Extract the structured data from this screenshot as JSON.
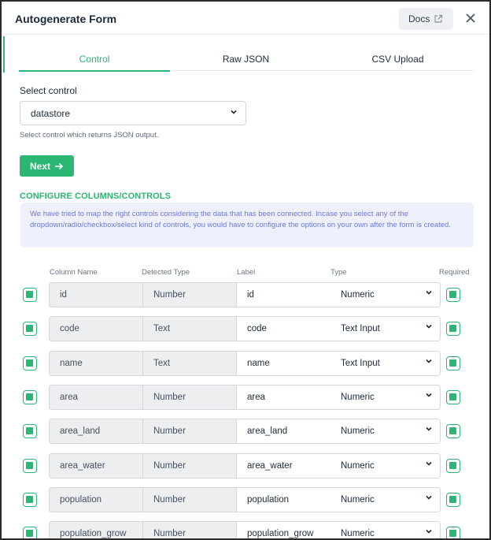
{
  "header": {
    "title": "Autogenerate Form",
    "docs_label": "Docs"
  },
  "tabs": [
    {
      "label": "Control",
      "active": true
    },
    {
      "label": "Raw JSON",
      "active": false
    },
    {
      "label": "CSV Upload",
      "active": false
    }
  ],
  "control": {
    "label": "Select control",
    "value": "datastore",
    "hint": "Select control which returns JSON output.",
    "next_label": "Next"
  },
  "configure": {
    "title": "CONFIGURE COLUMNS/CONTROLS",
    "info": "We have tried to map the right controls considering the data that has been connected. Incase you select any of the dropdown/radio/checkbox/select kind of controls, you would have to configure the options on your own after the form is created."
  },
  "columns": {
    "headers": [
      "Column Name",
      "Detected Type",
      "Label",
      "Type",
      "Required"
    ],
    "rows": [
      {
        "name": "id",
        "detected": "Number",
        "label": "id",
        "type": "Numeric"
      },
      {
        "name": "code",
        "detected": "Text",
        "label": "code",
        "type": "Text Input"
      },
      {
        "name": "name",
        "detected": "Text",
        "label": "name",
        "type": "Text Input"
      },
      {
        "name": "area",
        "detected": "Number",
        "label": "area",
        "type": "Numeric"
      },
      {
        "name": "area_land",
        "detected": "Number",
        "label": "area_land",
        "type": "Numeric"
      },
      {
        "name": "area_water",
        "detected": "Number",
        "label": "area_water",
        "type": "Numeric"
      },
      {
        "name": "population",
        "detected": "Number",
        "label": "population",
        "type": "Numeric"
      },
      {
        "name": "population_grow",
        "detected": "Number",
        "label": "population_grow",
        "type": "Numeric"
      }
    ]
  },
  "colors": {
    "accent": "#2cb673",
    "info_bg": "#eef0fb",
    "info_text": "#6d7bd6"
  },
  "icons": {
    "docs": "external-link-icon",
    "close": "close-icon",
    "next": "arrow-right-icon",
    "dropdown": "chevron-down-icon",
    "checkbox": "checkbox-checked-icon"
  }
}
